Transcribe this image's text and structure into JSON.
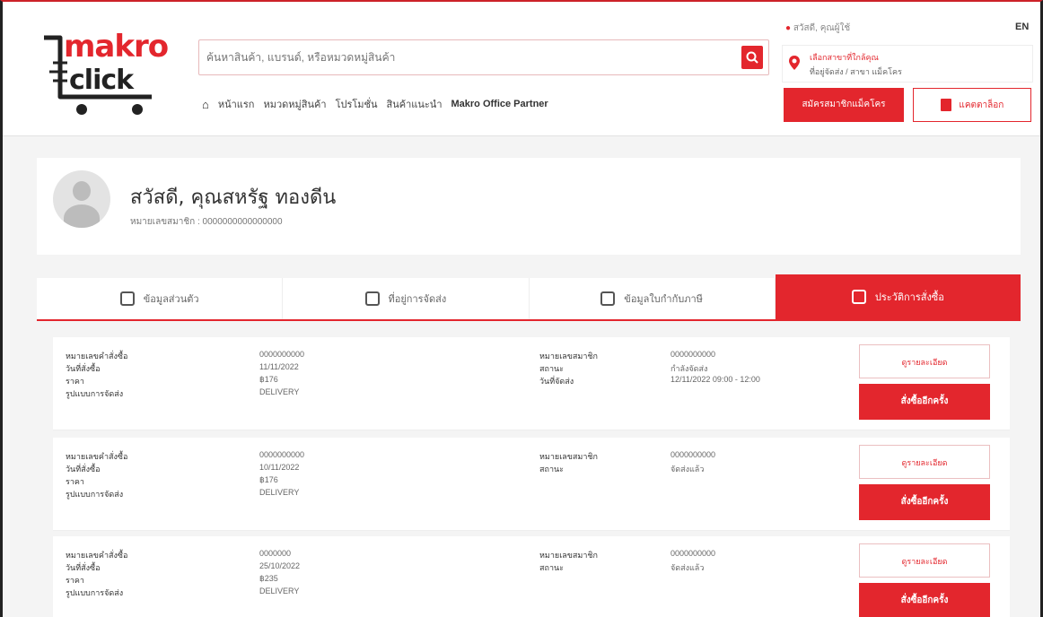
{
  "brand": {
    "top": "makro",
    "bottom": "click",
    "accent": "#e3262d"
  },
  "search": {
    "placeholder": "ค้นหาสินค้า, แบรนด์, หรือหมวดหมู่สินค้า"
  },
  "nav": {
    "items": [
      "หน้าแรก",
      "หมวดหมู่สินค้า",
      "โปรโมชั่น",
      "สินค้าแนะนำ",
      "Makro Office Partner"
    ]
  },
  "user": {
    "top_line": "สวัสดี, คุณผู้ใช้",
    "lang": "EN",
    "store_line1": "เลือกสาขาที่ใกล้คุณ",
    "store_line2": "ที่อยู่จัดส่ง / สาขา แม็คโคร"
  },
  "buttons": {
    "register": "สมัครสมาชิกแม็คโคร",
    "catalog": "แคตตาล็อก"
  },
  "profile": {
    "greeting": "สวัสดี, คุณสหรัฐ ทองดีน",
    "member": "หมายเลขสมาชิก : 0000000000000000"
  },
  "tabs": [
    "ข้อมูลส่วนตัว",
    "ที่อยู่การจัดส่ง",
    "ข้อมูลใบกำกับภาษี",
    "ประวัติการสั่งซื้อ"
  ],
  "orders": [
    {
      "left": [
        [
          "หมายเลขคำสั่งซื้อ",
          "0000000000"
        ],
        [
          "วันที่สั่งซื้อ",
          "11/11/2022"
        ],
        [
          "ราคา",
          "฿176"
        ],
        [
          "รูปแบบการจัดส่ง",
          "DELIVERY"
        ]
      ],
      "right": [
        [
          "หมายเลขสมาชิก",
          "0000000000"
        ],
        [
          "สถานะ",
          "กำลังจัดส่ง"
        ],
        [
          "วันที่จัดส่ง",
          "12/11/2022 09:00 - 12:00"
        ]
      ],
      "detail": "ดูรายละเอียด",
      "reorder": "สั่งซื้ออีกครั้ง"
    },
    {
      "left": [
        [
          "หมายเลขคำสั่งซื้อ",
          "0000000000"
        ],
        [
          "วันที่สั่งซื้อ",
          "10/11/2022"
        ],
        [
          "ราคา",
          "฿176"
        ],
        [
          "รูปแบบการจัดส่ง",
          "DELIVERY"
        ]
      ],
      "right": [
        [
          "หมายเลขสมาชิก",
          "0000000000"
        ],
        [
          "สถานะ",
          "จัดส่งแล้ว"
        ]
      ],
      "detail": "ดูรายละเอียด",
      "reorder": "สั่งซื้ออีกครั้ง"
    },
    {
      "left": [
        [
          "หมายเลขคำสั่งซื้อ",
          "0000000"
        ],
        [
          "วันที่สั่งซื้อ",
          "25/10/2022"
        ],
        [
          "ราคา",
          "฿235"
        ],
        [
          "รูปแบบการจัดส่ง",
          "DELIVERY"
        ]
      ],
      "right": [
        [
          "หมายเลขสมาชิก",
          "0000000000"
        ],
        [
          "สถานะ",
          "จัดส่งแล้ว"
        ]
      ],
      "detail": "ดูรายละเอียด",
      "reorder": "สั่งซื้ออีกครั้ง"
    }
  ]
}
